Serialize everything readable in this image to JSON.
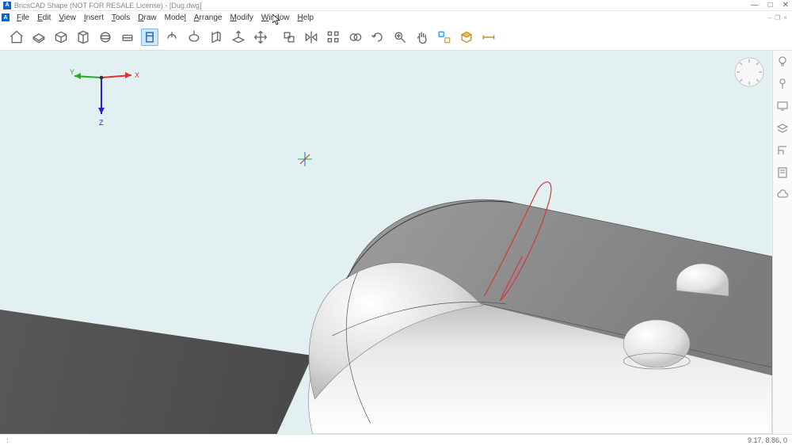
{
  "title": "BricsCAD Shape (NOT FOR RESALE License) - [Dug.dwg]",
  "app_icon_letter": "A",
  "window_controls": {
    "minimize": "—",
    "maximize": "□",
    "close": "✕"
  },
  "menu": {
    "doc_icon_letter": "A",
    "items": [
      "File",
      "Edit",
      "View",
      "Insert",
      "Tools",
      "Draw",
      "Model",
      "Arrange",
      "Modify",
      "Window",
      "Help"
    ],
    "small": {
      "minimize": "–",
      "restore": "❐",
      "close": "×"
    }
  },
  "toolbar": {
    "items": [
      "home-icon",
      "new-icon",
      "open-icon",
      "save-icon",
      "sphere-icon",
      "extrude-icon",
      "push-pull-icon",
      "revolve-icon",
      "sweep-icon",
      "loft-icon",
      "slice-icon",
      "move-icon",
      "copy-icon",
      "mirror-icon",
      "array-icon",
      "union-icon",
      "rotate-icon",
      "zoom-extents-icon",
      "pan-icon",
      "selection-icon",
      "materials-icon",
      "measure-icon"
    ],
    "active_index": 6
  },
  "right_panel": {
    "items": [
      "bulb-icon",
      "pin-icon",
      "display-icon",
      "layers-icon",
      "section-icon",
      "sheet-icon",
      "cloud-icon"
    ]
  },
  "viewport": {
    "ucs_labels": {
      "x": "X",
      "y": "Y",
      "z": "Z"
    }
  },
  "statusbar": {
    "prompt": ":",
    "coords": "9.17, 8.86, 0"
  }
}
